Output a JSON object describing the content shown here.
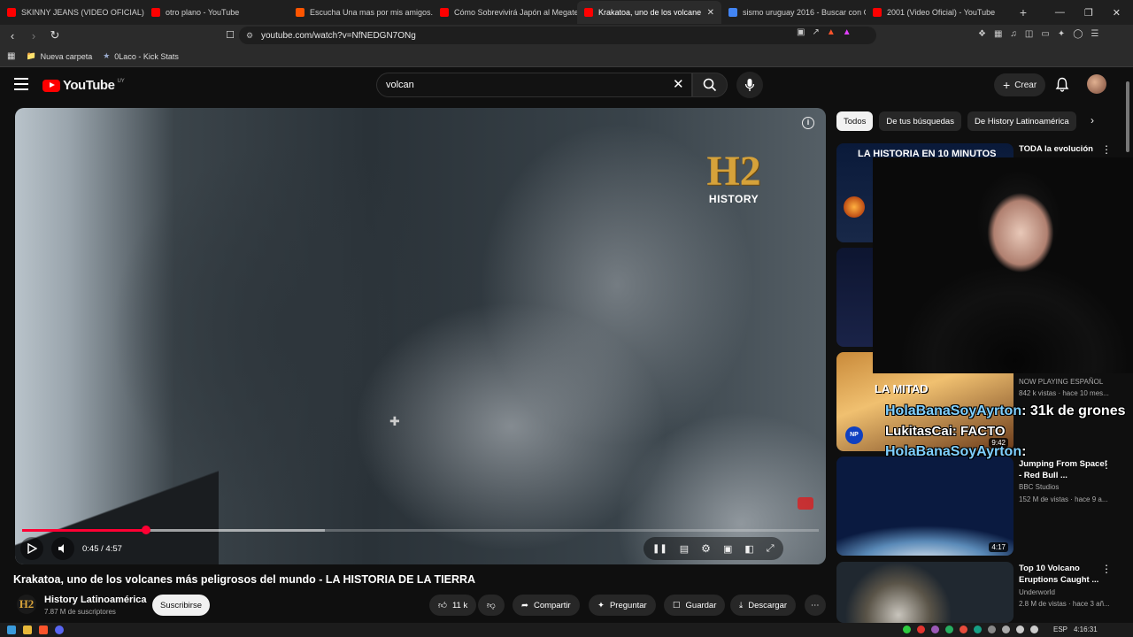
{
  "browser": {
    "tabs": [
      {
        "label": "SKINNY JEANS (VIDEO OFICIAL) - Yo",
        "color": "#ff0000"
      },
      {
        "label": "otro plano - YouTube",
        "color": "#ff0000"
      },
      {
        "label": "Escucha Una mas por mis amigos. P",
        "color": "#ff5500"
      },
      {
        "label": "Cómo Sobrevivirá Japón al Megaterr",
        "color": "#ff0000"
      },
      {
        "label": "Krakatoa, uno de los volcane",
        "color": "#ff0000",
        "active": true
      },
      {
        "label": "sismo uruguay 2016 - Buscar con Go",
        "color": "#4285f4"
      },
      {
        "label": "2001 (Video Oficial) - YouTube",
        "color": "#ff0000"
      }
    ],
    "new_tab": "+",
    "url": "youtube.com/watch?v=NfNEDGN7ONg",
    "bookmarks": [
      {
        "label": "Nueva carpeta",
        "icon": "folder-icon"
      },
      {
        "label": "0Laco - Kick Stats",
        "icon": "star-icon"
      }
    ]
  },
  "youtube": {
    "logo_text": "YouTube",
    "country": "UY",
    "search_value": "volcan",
    "create_label": "Crear",
    "player": {
      "channel_brand": "H2",
      "channel_brand_sub": "HISTORY",
      "current_time": "0:45",
      "duration": "4:57",
      "time_display": "0:45 / 4:57",
      "progress_fraction": 0.155,
      "buffered_fraction": 0.38
    },
    "video": {
      "title": "Krakatoa, uno de los volcanes más peligrosos del mundo - LA HISTORIA DE LA TIERRA",
      "channel": "History Latinoamérica",
      "subscribers": "7.87 M de suscriptores",
      "subscribe_label": "Suscribirse",
      "likes": "11 k",
      "share_label": "Compartir",
      "ask_label": "Preguntar",
      "save_label": "Guardar",
      "download_label": "Descargar"
    },
    "chips": [
      {
        "label": "Todos",
        "active": true
      },
      {
        "label": "De tus búsquedas",
        "active": false
      },
      {
        "label": "De History Latinoamérica",
        "active": false
      }
    ],
    "recommendations": [
      {
        "title": "TODA la evolución",
        "thumb_text": "LA HISTORIA EN 10 MINUTOS",
        "channel": "",
        "meta": "",
        "duration": ""
      },
      {
        "title": "",
        "thumb_text": "",
        "channel": "NOW PLAYING ESPAÑOL",
        "meta": "842 k vistas · hace 10 mes...",
        "duration": "9:42",
        "thumb_caption": "LA MITAD"
      },
      {
        "title": "Jumping From Space! - Red Bull ...",
        "channel": "BBC Studios",
        "meta": "152 M de vistas · hace 9 a...",
        "duration": "4:17"
      },
      {
        "title": "Top 10 Volcano Eruptions Caught ...",
        "channel": "Underworld",
        "meta": "2.8 M de vistas · hace 3 añ...",
        "duration": ""
      }
    ],
    "overlay_chat": [
      {
        "user": "HolaBanaSoyAyrton",
        "message": ": 31k de grones"
      },
      {
        "user": "LukitasCai",
        "message": ": FACTO"
      },
      {
        "user": "HolaBanaSoyAyrton",
        "message": ":"
      }
    ]
  },
  "taskbar": {
    "lang": "ESP",
    "time": "4:16:31"
  }
}
